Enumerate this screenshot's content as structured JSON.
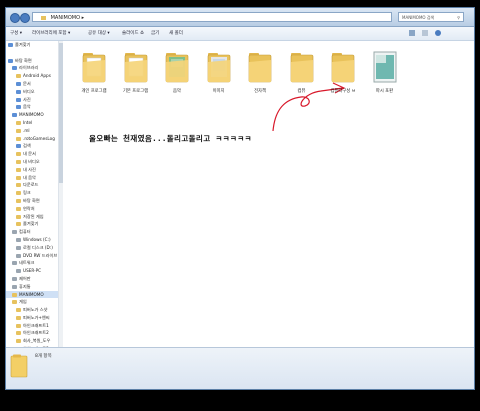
{
  "window": {
    "address_path": "MANIMOMO",
    "search_placeholder": "MANIMOMO 검색"
  },
  "toolbar": {
    "items": [
      "구성 ▾",
      "라이브러리에 포함 ▾",
      "공유 대상 ▾",
      "슬라이드 쇼",
      "굽기",
      "새 폴더"
    ]
  },
  "sidebar": {
    "items": [
      {
        "label": "즐겨찾기",
        "icon": "star-icon",
        "indent": 0
      },
      {
        "label": "",
        "icon": "",
        "indent": 0
      },
      {
        "label": "바탕 화면",
        "icon": "desktop-icon",
        "indent": 0
      },
      {
        "label": "라이브러리",
        "icon": "library-icon",
        "indent": 1
      },
      {
        "label": "Android Apps",
        "icon": "folder-icon",
        "indent": 2
      },
      {
        "label": "문서",
        "icon": "documents-icon",
        "indent": 2
      },
      {
        "label": "비디오",
        "icon": "video-icon",
        "indent": 2
      },
      {
        "label": "사진",
        "icon": "pictures-icon",
        "indent": 2
      },
      {
        "label": "음악",
        "icon": "music-icon",
        "indent": 2
      },
      {
        "label": "MANIMOMO",
        "icon": "user-icon",
        "indent": 1
      },
      {
        "label": "Intel",
        "icon": "folder-icon",
        "indent": 2
      },
      {
        "label": ".ml",
        "icon": "folder-icon",
        "indent": 2
      },
      {
        "label": ".rotoGamesLog",
        "icon": "folder-icon",
        "indent": 2
      },
      {
        "label": "검색",
        "icon": "search-icon",
        "indent": 2
      },
      {
        "label": "내 문서",
        "icon": "folder-icon",
        "indent": 2
      },
      {
        "label": "내 비디오",
        "icon": "folder-icon",
        "indent": 2
      },
      {
        "label": "내 사진",
        "icon": "folder-icon",
        "indent": 2
      },
      {
        "label": "내 음악",
        "icon": "folder-icon",
        "indent": 2
      },
      {
        "label": "다운로드",
        "icon": "folder-icon",
        "indent": 2
      },
      {
        "label": "링크",
        "icon": "folder-icon",
        "indent": 2
      },
      {
        "label": "바탕 화면",
        "icon": "folder-icon",
        "indent": 2
      },
      {
        "label": "연락처",
        "icon": "folder-icon",
        "indent": 2
      },
      {
        "label": "저장된 게임",
        "icon": "folder-icon",
        "indent": 2
      },
      {
        "label": "즐겨찾기",
        "icon": "folder-icon",
        "indent": 2
      },
      {
        "label": "컴퓨터",
        "icon": "computer-icon",
        "indent": 1
      },
      {
        "label": "Windows (C:)",
        "icon": "drive-icon",
        "indent": 2
      },
      {
        "label": "로컬 디스크 (D:)",
        "icon": "drive-icon",
        "indent": 2
      },
      {
        "label": "DVD RW 드라이브",
        "icon": "dvd-icon",
        "indent": 2
      },
      {
        "label": "네트워크",
        "icon": "network-icon",
        "indent": 1
      },
      {
        "label": "USER-PC",
        "icon": "computer-icon",
        "indent": 2
      },
      {
        "label": "제어판",
        "icon": "control-panel-icon",
        "indent": 1
      },
      {
        "label": "휴지통",
        "icon": "recycle-bin-icon",
        "indent": 1
      },
      {
        "label": "MANIMOMO",
        "icon": "folder-icon",
        "indent": 1,
        "selected": true
      },
      {
        "label": "게임",
        "icon": "folder-icon",
        "indent": 1
      },
      {
        "label": "피버노가 스샷",
        "icon": "folder-icon",
        "indent": 2
      },
      {
        "label": "피버노가+엔씨",
        "icon": "folder-icon",
        "indent": 2
      },
      {
        "label": "아인크래프트1",
        "icon": "folder-icon",
        "indent": 2
      },
      {
        "label": "아인크래프트2",
        "icon": "folder-icon",
        "indent": 2
      },
      {
        "label": "회사_복원_도우",
        "icon": "folder-icon",
        "indent": 2
      },
      {
        "label": "아인크래프트3",
        "icon": "folder-icon",
        "indent": 2
      }
    ]
  },
  "folders": [
    {
      "label": "개인 프로그램",
      "icon": "folder-icon"
    },
    {
      "label": "기본 프로그램",
      "icon": "folder-icon"
    },
    {
      "label": "음악",
      "icon": "music-folder-icon"
    },
    {
      "label": "이미지",
      "icon": "pictures-folder-icon"
    },
    {
      "label": "전자책",
      "icon": "folder-icon"
    },
    {
      "label": "컴퓨",
      "icon": "folder-icon"
    },
    {
      "label": "컴퓨터구성 ㅂ",
      "icon": "folder-icon"
    },
    {
      "label": "파시 포판",
      "icon": "image-file-icon"
    }
  ],
  "caption": "울오빠는 천재였음...돌리고돌리고 ㅋㅋㅋㅋㅋ",
  "statusbar": {
    "item_count": "8개 항목"
  },
  "colors": {
    "annotation_red": "#d8182a",
    "folder_yellow": "#f3cf66",
    "selection_blue": "#cfe0f5"
  }
}
